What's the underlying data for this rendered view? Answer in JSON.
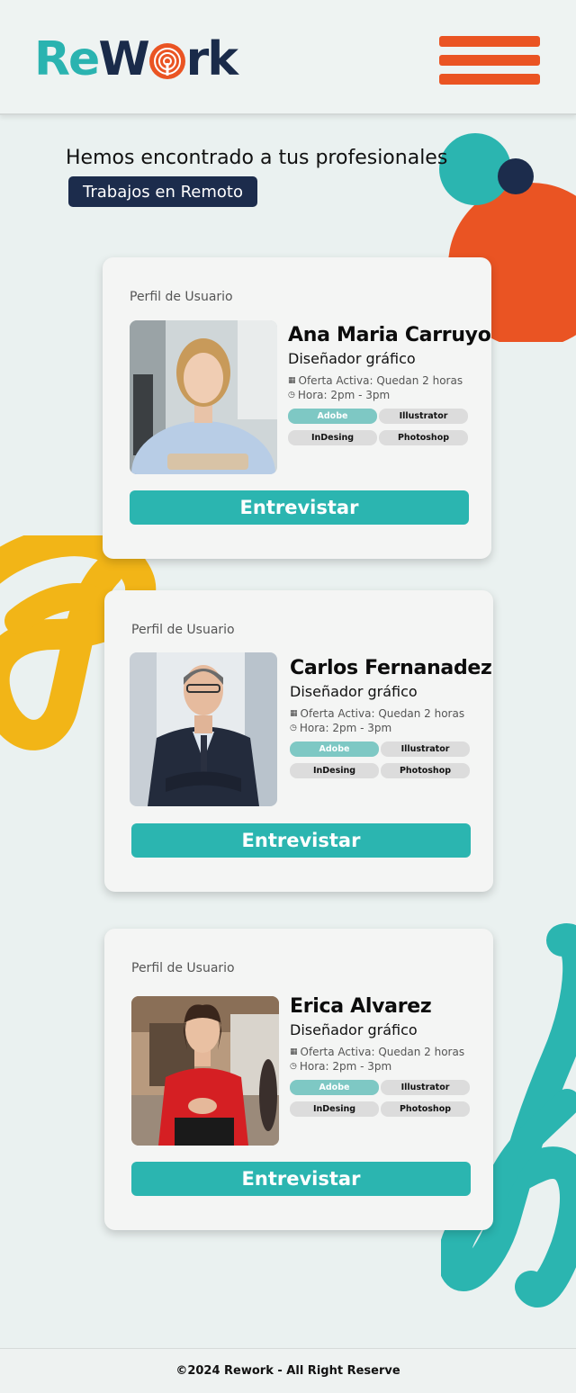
{
  "brand": {
    "logo_re": "Re",
    "logo_w": "W",
    "logo_rk": "rk",
    "colors": {
      "teal": "#2bb5b0",
      "orange": "#ea5423",
      "navy": "#1c2c4c",
      "yellow": "#f2b517"
    }
  },
  "header": {
    "menu_icon": "hamburger-menu-icon"
  },
  "intro": {
    "headline": "Hemos encontrado a tus profesionales",
    "tag": "Trabajos en Remoto"
  },
  "profiles": [
    {
      "label": "Perfil de Usuario",
      "name": "Ana Maria Carruyo",
      "role": "Diseñador gráfico",
      "offer": "Oferta Activa: Quedan 2 horas",
      "hours": "Hora: 2pm - 3pm",
      "skills": [
        "Adobe",
        "Illustrator",
        "InDesing",
        "Photoshop"
      ],
      "cta": "Entrevistar"
    },
    {
      "label": "Perfil de Usuario",
      "name": "Carlos Fernanadez",
      "role": "Diseñador gráfico",
      "offer": "Oferta Activa: Quedan 2 horas",
      "hours": "Hora: 2pm - 3pm",
      "skills": [
        "Adobe",
        "Illustrator",
        "InDesing",
        "Photoshop"
      ],
      "cta": "Entrevistar"
    },
    {
      "label": "Perfil de Usuario",
      "name": "Erica Alvarez",
      "role": "Diseñador gráfico",
      "offer": "Oferta Activa: Quedan 2 horas",
      "hours": "Hora: 2pm - 3pm",
      "skills": [
        "Adobe",
        "Illustrator",
        "InDesing",
        "Photoshop"
      ],
      "cta": "Entrevistar"
    }
  ],
  "footer": {
    "text": "©2024 Rework - All Right Reserve"
  }
}
